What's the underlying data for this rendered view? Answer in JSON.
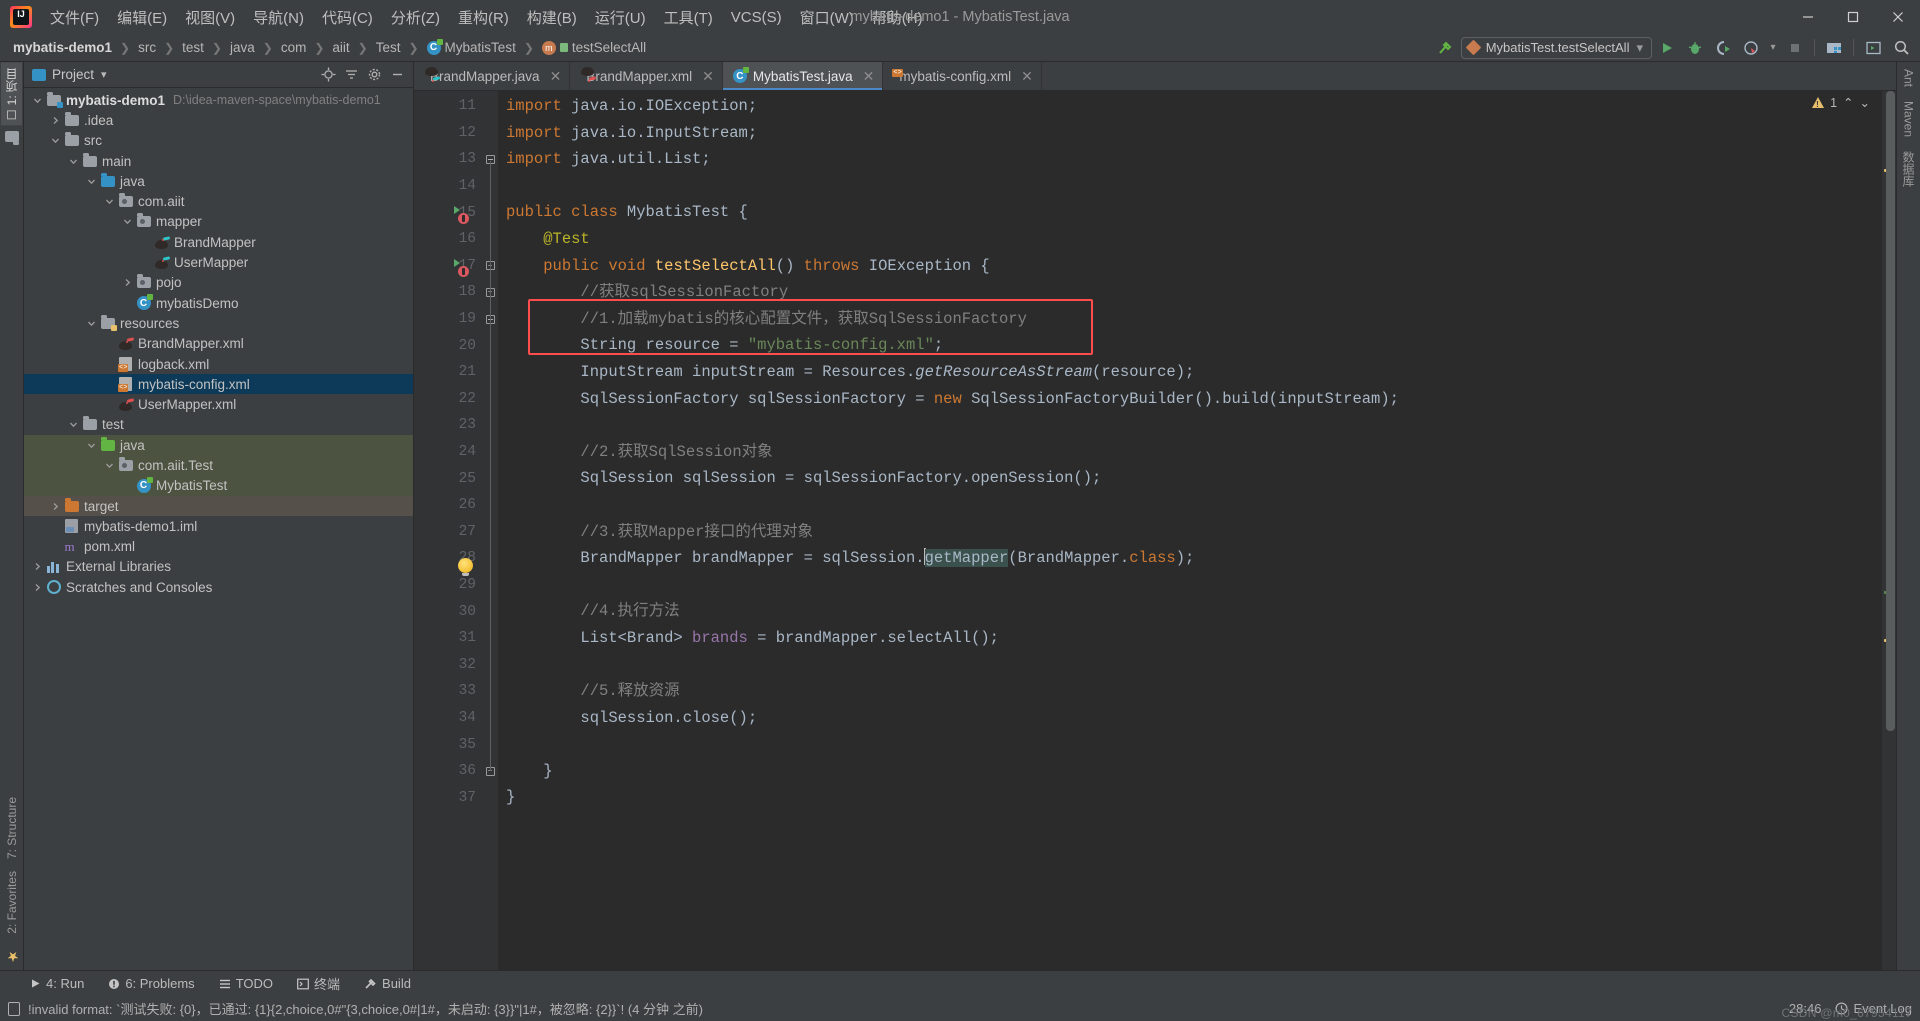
{
  "window": {
    "title": "mybatis-demo1 - MybatisTest.java",
    "minimize": "—",
    "maximize": "▢",
    "close": "✕"
  },
  "menu": {
    "items": [
      "文件(F)",
      "编辑(E)",
      "视图(V)",
      "导航(N)",
      "代码(C)",
      "分析(Z)",
      "重构(R)",
      "构建(B)",
      "运行(U)",
      "工具(T)",
      "VCS(S)",
      "窗口(W)",
      "帮助(H)"
    ]
  },
  "breadcrumbs": {
    "items": [
      {
        "label": "mybatis-demo1",
        "icon": "",
        "bold": true
      },
      {
        "label": "src",
        "icon": ""
      },
      {
        "label": "test",
        "icon": ""
      },
      {
        "label": "java",
        "icon": ""
      },
      {
        "label": "com",
        "icon": ""
      },
      {
        "label": "aiit",
        "icon": ""
      },
      {
        "label": "Test",
        "icon": ""
      },
      {
        "label": "MybatisTest",
        "icon": "class-icon"
      },
      {
        "label": "testSelectAll",
        "icon": "method-icon"
      }
    ],
    "separator": "❯"
  },
  "toolbar": {
    "run_config": "MybatisTest.testSelectAll",
    "dropdown_arrow": "▾",
    "buttons": [
      "build-hammer-icon",
      "run-icon",
      "debug-icon",
      "run-coverage-icon",
      "profiler-icon",
      "stop-icon",
      "project-structure-icon",
      "open-terminal-icon",
      "search-everywhere-icon"
    ]
  },
  "project_panel": {
    "title": "Project",
    "dropdown_arrow": "▾",
    "actions": [
      "locate-icon",
      "collapse-all-icon",
      "settings-gear-icon",
      "hide-icon"
    ],
    "tree": [
      {
        "depth": 0,
        "arrow": "v",
        "icon": "module-folder",
        "label": "mybatis-demo1",
        "bold": true,
        "path": "D:\\idea-maven-space\\mybatis-demo1"
      },
      {
        "depth": 1,
        "arrow": ">",
        "icon": "folder-grey",
        "label": ".idea"
      },
      {
        "depth": 1,
        "arrow": "v",
        "icon": "folder-grey",
        "label": "src"
      },
      {
        "depth": 2,
        "arrow": "v",
        "icon": "folder-grey",
        "label": "main"
      },
      {
        "depth": 3,
        "arrow": "v",
        "icon": "folder-blue",
        "label": "java"
      },
      {
        "depth": 4,
        "arrow": "v",
        "icon": "package",
        "label": "com.aiit"
      },
      {
        "depth": 5,
        "arrow": "v",
        "icon": "package",
        "label": "mapper"
      },
      {
        "depth": 6,
        "arrow": "",
        "icon": "mybatis-bird-cyan",
        "label": "BrandMapper"
      },
      {
        "depth": 6,
        "arrow": "",
        "icon": "mybatis-bird-cyan",
        "label": "UserMapper"
      },
      {
        "depth": 5,
        "arrow": ">",
        "icon": "package",
        "label": "pojo"
      },
      {
        "depth": 5,
        "arrow": "",
        "icon": "class",
        "label": "mybatisDemo"
      },
      {
        "depth": 3,
        "arrow": "v",
        "icon": "folder-resources",
        "label": "resources"
      },
      {
        "depth": 4,
        "arrow": "",
        "icon": "mybatis-bird-red",
        "label": "BrandMapper.xml"
      },
      {
        "depth": 4,
        "arrow": "",
        "icon": "xml",
        "label": "logback.xml"
      },
      {
        "depth": 4,
        "arrow": "",
        "icon": "xml",
        "label": "mybatis-config.xml",
        "selected": true
      },
      {
        "depth": 4,
        "arrow": "",
        "icon": "mybatis-bird-red",
        "label": "UserMapper.xml"
      },
      {
        "depth": 2,
        "arrow": "v",
        "icon": "folder-grey",
        "label": "test"
      },
      {
        "depth": 3,
        "arrow": "v",
        "icon": "folder-green",
        "label": "java",
        "testbg": true
      },
      {
        "depth": 4,
        "arrow": "v",
        "icon": "package",
        "label": "com.aiit.Test",
        "testbg": true
      },
      {
        "depth": 5,
        "arrow": "",
        "icon": "class-test",
        "label": "MybatisTest",
        "testbg": true
      },
      {
        "depth": 1,
        "arrow": ">",
        "icon": "folder-orange",
        "label": "target",
        "targetbg": true
      },
      {
        "depth": 1,
        "arrow": "",
        "icon": "iml",
        "label": "mybatis-demo1.iml"
      },
      {
        "depth": 1,
        "arrow": "",
        "icon": "maven",
        "label": "pom.xml"
      },
      {
        "depth": 0,
        "arrow": ">",
        "icon": "libraries",
        "label": "External Libraries"
      },
      {
        "depth": 0,
        "arrow": ">",
        "icon": "scratches",
        "label": "Scratches and Consoles"
      }
    ]
  },
  "left_rail": {
    "tabs": [
      "1: 项目"
    ],
    "bottom_tabs": [
      "7: Structure",
      "2: Favorites"
    ]
  },
  "right_rail": {
    "tabs": [
      "Ant",
      "Maven",
      "数据库"
    ]
  },
  "editor": {
    "tabs": [
      {
        "label": "BrandMapper.java",
        "icon": "mybatis-bird-cyan",
        "close": "✕",
        "active": false
      },
      {
        "label": "BrandMapper.xml",
        "icon": "mybatis-bird-red",
        "close": "✕",
        "active": false
      },
      {
        "label": "MybatisTest.java",
        "icon": "class-test",
        "close": "✕",
        "active": true
      },
      {
        "label": "mybatis-config.xml",
        "icon": "xml",
        "close": "✕",
        "active": false
      }
    ],
    "warning_count": "1",
    "warning_collapse": "⌃",
    "warning_expand": "⌄",
    "first_line_number": 11,
    "lines": [
      {
        "n": 11,
        "marker": "",
        "fold": "",
        "tokens": [
          {
            "c": "k",
            "t": "import"
          },
          {
            "c": "",
            "t": " java.io.IOException;"
          }
        ]
      },
      {
        "n": 12,
        "marker": "",
        "fold": "",
        "tokens": [
          {
            "c": "k",
            "t": "import"
          },
          {
            "c": "",
            "t": " java.io.InputStream;"
          }
        ]
      },
      {
        "n": 13,
        "marker": "",
        "fold": "brace",
        "tokens": [
          {
            "c": "k",
            "t": "import"
          },
          {
            "c": "",
            "t": " java.util.List;"
          }
        ]
      },
      {
        "n": 14,
        "marker": "",
        "fold": "",
        "tokens": []
      },
      {
        "n": 15,
        "marker": "run",
        "fold": "",
        "tokens": [
          {
            "c": "k",
            "t": "public class "
          },
          {
            "c": "",
            "t": "MybatisTest {"
          }
        ]
      },
      {
        "n": 16,
        "marker": "",
        "fold": "",
        "tokens": [
          {
            "c": "",
            "t": "    "
          },
          {
            "c": "a",
            "t": "@Test"
          }
        ]
      },
      {
        "n": 17,
        "marker": "run",
        "fold": "minus",
        "tokens": [
          {
            "c": "",
            "t": "    "
          },
          {
            "c": "k",
            "t": "public void "
          },
          {
            "c": "t",
            "t": "testSelectAll"
          },
          {
            "c": "",
            "t": "() "
          },
          {
            "c": "k",
            "t": "throws "
          },
          {
            "c": "",
            "t": "IOException {"
          }
        ]
      },
      {
        "n": 18,
        "marker": "",
        "fold": "minus",
        "tokens": [
          {
            "c": "",
            "t": "        "
          },
          {
            "c": "c",
            "t": "//获取sqlSessionFactory"
          }
        ]
      },
      {
        "n": 19,
        "marker": "",
        "fold": "brace",
        "tokens": [
          {
            "c": "",
            "t": "        "
          },
          {
            "c": "c",
            "t": "//1.加载mybatis的核心配置文件，获取SqlSessionFactory"
          }
        ]
      },
      {
        "n": 20,
        "marker": "",
        "fold": "",
        "tokens": [
          {
            "c": "",
            "t": "        String resource = "
          },
          {
            "c": "s",
            "t": "\"mybatis-config.xml\""
          },
          {
            "c": "",
            "t": ";"
          }
        ]
      },
      {
        "n": 21,
        "marker": "",
        "fold": "",
        "tokens": [
          {
            "c": "",
            "t": "        InputStream inputStream = Resources."
          },
          {
            "c": "m",
            "t": "getResourceAsStream"
          },
          {
            "c": "",
            "t": "(resource);"
          }
        ]
      },
      {
        "n": 22,
        "marker": "",
        "fold": "",
        "tokens": [
          {
            "c": "",
            "t": "        SqlSessionFactory sqlSessionFactory = "
          },
          {
            "c": "k",
            "t": "new "
          },
          {
            "c": "",
            "t": "SqlSessionFactoryBuilder().build(inputStream);"
          }
        ]
      },
      {
        "n": 23,
        "marker": "",
        "fold": "",
        "tokens": []
      },
      {
        "n": 24,
        "marker": "",
        "fold": "",
        "tokens": [
          {
            "c": "",
            "t": "        "
          },
          {
            "c": "c",
            "t": "//2.获取SqlSession对象"
          }
        ]
      },
      {
        "n": 25,
        "marker": "",
        "fold": "",
        "tokens": [
          {
            "c": "",
            "t": "        SqlSession sqlSession = sqlSessionFactory.openSession();"
          }
        ]
      },
      {
        "n": 26,
        "marker": "",
        "fold": "",
        "tokens": []
      },
      {
        "n": 27,
        "marker": "",
        "fold": "",
        "tokens": [
          {
            "c": "",
            "t": "        "
          },
          {
            "c": "c",
            "t": "//3.获取Mapper接口的代理对象"
          }
        ]
      },
      {
        "n": 28,
        "marker": "bulb",
        "fold": "",
        "tokens": [
          {
            "c": "",
            "t": "        BrandMapper brandMapper = sqlSession."
          },
          {
            "c": "caret",
            "t": ""
          },
          {
            "c": "hl",
            "t": "getMapper"
          },
          {
            "c": "",
            "t": "(BrandMapper."
          },
          {
            "c": "k",
            "t": "class"
          },
          {
            "c": "",
            "t": ");"
          }
        ]
      },
      {
        "n": 29,
        "marker": "",
        "fold": "",
        "tokens": []
      },
      {
        "n": 30,
        "marker": "",
        "fold": "",
        "tokens": [
          {
            "c": "",
            "t": "        "
          },
          {
            "c": "c",
            "t": "//4.执行方法"
          }
        ]
      },
      {
        "n": 31,
        "marker": "",
        "fold": "",
        "tokens": [
          {
            "c": "",
            "t": "        List<Brand> "
          },
          {
            "c": "f2",
            "t": "brands"
          },
          {
            "c": "",
            "t": " = brandMapper.selectAll();"
          }
        ]
      },
      {
        "n": 32,
        "marker": "",
        "fold": "",
        "tokens": []
      },
      {
        "n": 33,
        "marker": "",
        "fold": "",
        "tokens": [
          {
            "c": "",
            "t": "        "
          },
          {
            "c": "c",
            "t": "//5.释放资源"
          }
        ]
      },
      {
        "n": 34,
        "marker": "",
        "fold": "",
        "tokens": [
          {
            "c": "",
            "t": "        sqlSession.close();"
          }
        ]
      },
      {
        "n": 35,
        "marker": "",
        "fold": "",
        "tokens": []
      },
      {
        "n": 36,
        "marker": "",
        "fold": "minus",
        "tokens": [
          {
            "c": "",
            "t": "    }"
          }
        ]
      },
      {
        "n": 37,
        "marker": "",
        "fold": "",
        "tokens": [
          {
            "c": "",
            "t": "}"
          }
        ]
      }
    ]
  },
  "bottom_tools": [
    {
      "label": "4: Run",
      "mnemonic": "4",
      "icon": "run-icon"
    },
    {
      "label": "6: Problems",
      "mnemonic": "6",
      "icon": "problems-icon"
    },
    {
      "label": "TODO",
      "mnemonic": "",
      "icon": "todo-icon"
    },
    {
      "label": "终端",
      "mnemonic": "",
      "icon": "terminal-icon"
    },
    {
      "label": "Build",
      "mnemonic": "",
      "icon": "build-icon"
    }
  ],
  "status": {
    "message": "!invalid format: `测试失败: {0}，已通过: {1}{2,choice,0#\"{3,choice,0#|1#，未启动: {3}}\"|1#，被忽略: {2}}`! (4 分钟 之前)",
    "caret_position": "28:46",
    "event_log": "Event Log",
    "watermark": "CSDN @m0_67954117"
  },
  "colors": {
    "accent": "#4a88c7",
    "selection": "#0d3a58",
    "test_source": "#4c5340",
    "annotation_box": "#ff4d4d",
    "keyword": "#cc7832",
    "string": "#6a8759",
    "comment": "#808080",
    "method": "#ffc66d"
  }
}
